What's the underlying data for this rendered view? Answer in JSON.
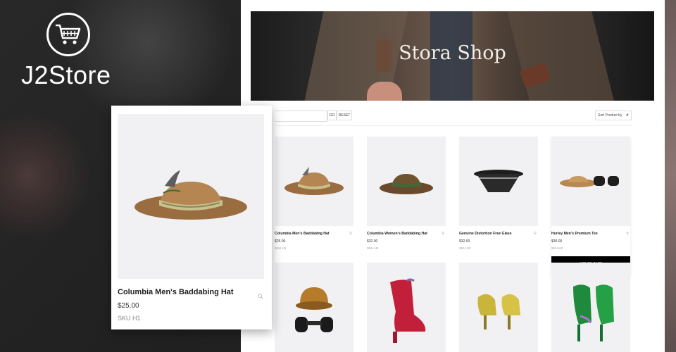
{
  "brand": {
    "name": "J2Store",
    "logo_icon": "shopping-cart-icon"
  },
  "shop": {
    "title": "Stora Shop",
    "search": {
      "value": "",
      "go_label": "GO",
      "reset_label": "RESET"
    },
    "sort": {
      "label": "Sort Product by"
    }
  },
  "products": [
    {
      "name": "Columbia Men's Baddabing Hat",
      "price": "$25.00",
      "sku": "SKU H1"
    },
    {
      "name": "Columbia Women's Baddabing Hat",
      "price": "$32.00",
      "sku": "SKU H2"
    },
    {
      "name": "Genuine Distortion Free Glass",
      "price": "$32.00",
      "sku": "SKU H2"
    },
    {
      "name": "Hurley Men's Premium Tee",
      "price": "$30.00",
      "sku": "SKU H2",
      "add_to_cart": "ADD TO CART"
    }
  ],
  "featured": {
    "name": "Columbia Men's Baddabing Hat",
    "price": "$25.00",
    "sku": "SKU H1"
  },
  "colors": {
    "accent": "#000000",
    "panel": "#f1f0f2"
  }
}
